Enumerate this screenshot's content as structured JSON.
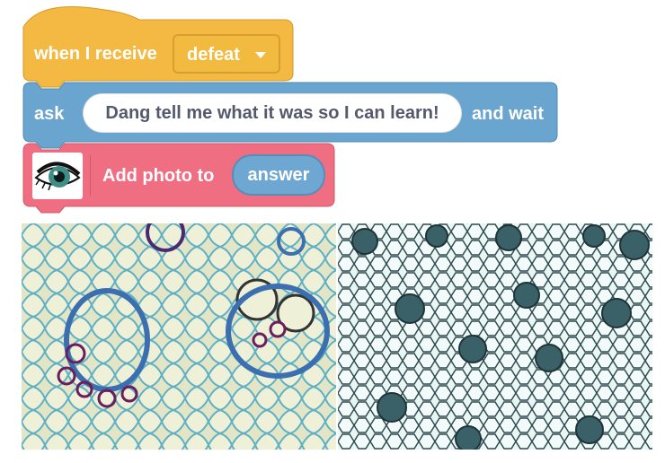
{
  "blocks": {
    "hat": {
      "label": "when I receive",
      "dropdown_value": "defeat",
      "color": "#f4b943"
    },
    "ask": {
      "label": "ask",
      "input_value": "Dang tell me what it was so I can learn!",
      "suffix": "and wait",
      "color": "#6aa5d0"
    },
    "photo": {
      "label": "Add photo to",
      "reporter": "answer",
      "icon": "eye-icon",
      "color": "#ef6e81"
    }
  },
  "images": [
    {
      "name": "micrograph-left",
      "tone": "blue-stained plant tissue"
    },
    {
      "name": "micrograph-right",
      "tone": "cyan-stained plant tissue"
    }
  ]
}
